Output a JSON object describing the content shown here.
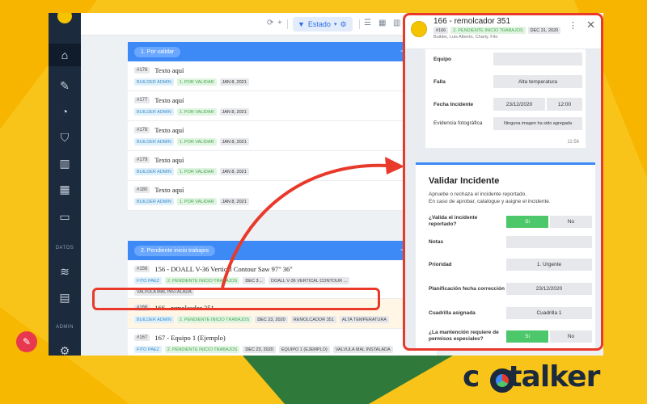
{
  "toolbar": {
    "filter_label": "Estado"
  },
  "sidebar": {
    "sections": [
      "DATOS",
      "ADMIN"
    ]
  },
  "groups": [
    {
      "label": "1. Por validar",
      "rows": [
        {
          "id": "#176",
          "title": "Texto aquí",
          "user": "BUILDER ADMIN",
          "status": "1. POR VALIDAR",
          "date": "JAN 8, 2021"
        },
        {
          "id": "#177",
          "title": "Texto aquí",
          "user": "BUILDER ADMIN",
          "status": "1. POR VALIDAR",
          "date": "JAN 8, 2021"
        },
        {
          "id": "#178",
          "title": "Texto aquí",
          "user": "BUILDER ADMIN",
          "status": "1. POR VALIDAR",
          "date": "JAN 8, 2021"
        },
        {
          "id": "#179",
          "title": "Texto aquí",
          "user": "BUILDER ADMIN",
          "status": "1. POR VALIDAR",
          "date": "JAN 8, 2021"
        },
        {
          "id": "#180",
          "title": "Texto aquí",
          "user": "BUILDER ADMIN",
          "status": "1. POR VALIDAR",
          "date": "JAN 8, 2021"
        }
      ]
    },
    {
      "label": "2. Pendiente inicio trabajos",
      "rows": [
        {
          "id": "#156",
          "title": "156 - DOALL V-36 Vertical Contour Saw 97\" 36\"",
          "user": "FITO PAEZ",
          "status": "2. PENDIENTE INICIO TRABAJOS",
          "date": "DEC 3…",
          "extra1": "DOALL V-36 VERTICAL CONTOUR ...",
          "extra2": "VALVULA MAL INSTALADA"
        },
        {
          "id": "#166",
          "title": "166 - remolcador 351",
          "user": "BUILDER ADMIN",
          "status": "2. PENDIENTE INICIO TRABAJOS",
          "date": "DEC 23, 2020",
          "extra1": "REMOLCADOR 351",
          "extra2": "ALTA TEMPERATURA"
        },
        {
          "id": "#167",
          "title": "167 - Equipo 1 (Ejemplo)",
          "user": "FITO PAEZ",
          "status": "2. PENDIENTE INICIO TRABAJOS",
          "date": "DEC 23, 2020",
          "extra1": "EQUIPO 1 (EJEMPLO)",
          "extra2": "VALVULA MAL INSTALADA"
        }
      ]
    }
  ],
  "panel": {
    "title": "166 - remolcador 351",
    "id": "#166",
    "status": "2. PENDIENTE INICIO TRABAJOS",
    "date": "DEC 31, 2020",
    "subtitle": "Builder, Luis Alberto, Charly, Fito",
    "form": {
      "equipo_label": "Equipo",
      "falla_label": "Falla",
      "falla_value": "Alta temperatura",
      "fecha_label": "Fecha Incidente",
      "fecha_value": "23/12/2020",
      "hora_value": "12:00",
      "evidencia_label": "Evidencia fotográfica",
      "evidencia_value": "Ninguna imagen ha sido agregada",
      "time": "11:56"
    },
    "validar": {
      "title": "Validar Incidente",
      "desc1": "Apruebe o rechaza el incidente reportado.",
      "desc2": "En caso de aprobar, catalogue y asigne el incidente.",
      "q1": "¿Valida el incidente reportado?",
      "si": "Si",
      "no": "No",
      "notas": "Notas",
      "prioridad": "Prioridad",
      "prioridad_value": "1. Urgente",
      "planif": "Planificación fecha corrección",
      "planif_value": "23/12/2020",
      "cuadrilla": "Cuadrilla asignada",
      "cuadrilla_value": "Cuadrilla 1",
      "q2": "¿La mantención requiere de permisos especiales?"
    }
  },
  "logo": {
    "text_left": "c",
    "text_right": "talker"
  },
  "colors": {
    "accent": "#3d8af7",
    "highlight": "#e8392a",
    "sidebar": "#1b2a3d",
    "background": "#f9c41a",
    "yes": "#4cc769"
  }
}
